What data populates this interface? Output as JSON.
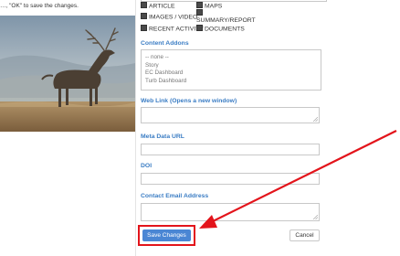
{
  "intro_text": "…, \"OK\" to save the changes.",
  "checkboxes": [
    {
      "label": "ARTICLE"
    },
    {
      "label": "MAPS"
    },
    {
      "label": "IMAGES / VIDEO"
    },
    {
      "label": "SUMMARY/REPORT"
    },
    {
      "label": "RECENT ACTIVITY"
    },
    {
      "label": "DOCUMENTS"
    }
  ],
  "content_addons": {
    "label": "Content Addons",
    "options": [
      "-- none --",
      "Story",
      "EC Dashboard",
      "Turb Dashboard"
    ]
  },
  "fields": {
    "web_link_label": "Web Link (Opens a new window)",
    "meta_data_url_label": "Meta Data URL",
    "doi_label": "DOI",
    "contact_email_label": "Contact Email Address"
  },
  "buttons": {
    "save": "Save Changes",
    "cancel": "Cancel"
  },
  "colors": {
    "accent_blue": "#3b7dc4",
    "save_button": "#4a86d4",
    "annotation_red": "#e3141b"
  }
}
